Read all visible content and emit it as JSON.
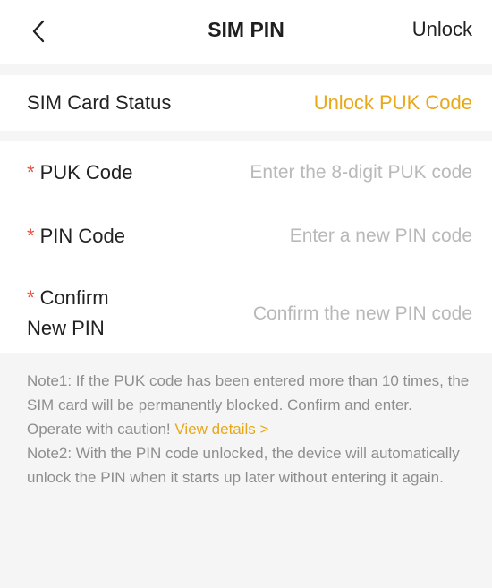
{
  "header": {
    "title": "SIM PIN",
    "action_label": "Unlock",
    "back_icon": "chevron-left-icon"
  },
  "status": {
    "label": "SIM Card Status",
    "value": "Unlock PUK Code"
  },
  "form": {
    "required_mark": "*",
    "puk": {
      "label": "PUK Code",
      "value": "",
      "placeholder": "Enter the 8-digit PUK code"
    },
    "pin": {
      "label": "PIN Code",
      "value": "",
      "placeholder": "Enter a new PIN code"
    },
    "confirm": {
      "label_line1": "Confirm",
      "label_line2": "New PIN",
      "value": "",
      "placeholder": "Confirm the new PIN code"
    }
  },
  "notes": {
    "note1": "Note1: If the PUK code has been entered more than 10 times, the SIM card will be permanently blocked. Confirm and enter. Operate with caution!",
    "view_details": "View details >",
    "note2": "Note2: With the PIN code unlocked, the device will automatically unlock the PIN when it starts up later without entering it again."
  },
  "colors": {
    "accent": "#e8a817",
    "required": "#e94b3c",
    "placeholder": "#b9b9b9",
    "note_text": "#8e8e8e",
    "page_background": "#f5f5f5"
  }
}
